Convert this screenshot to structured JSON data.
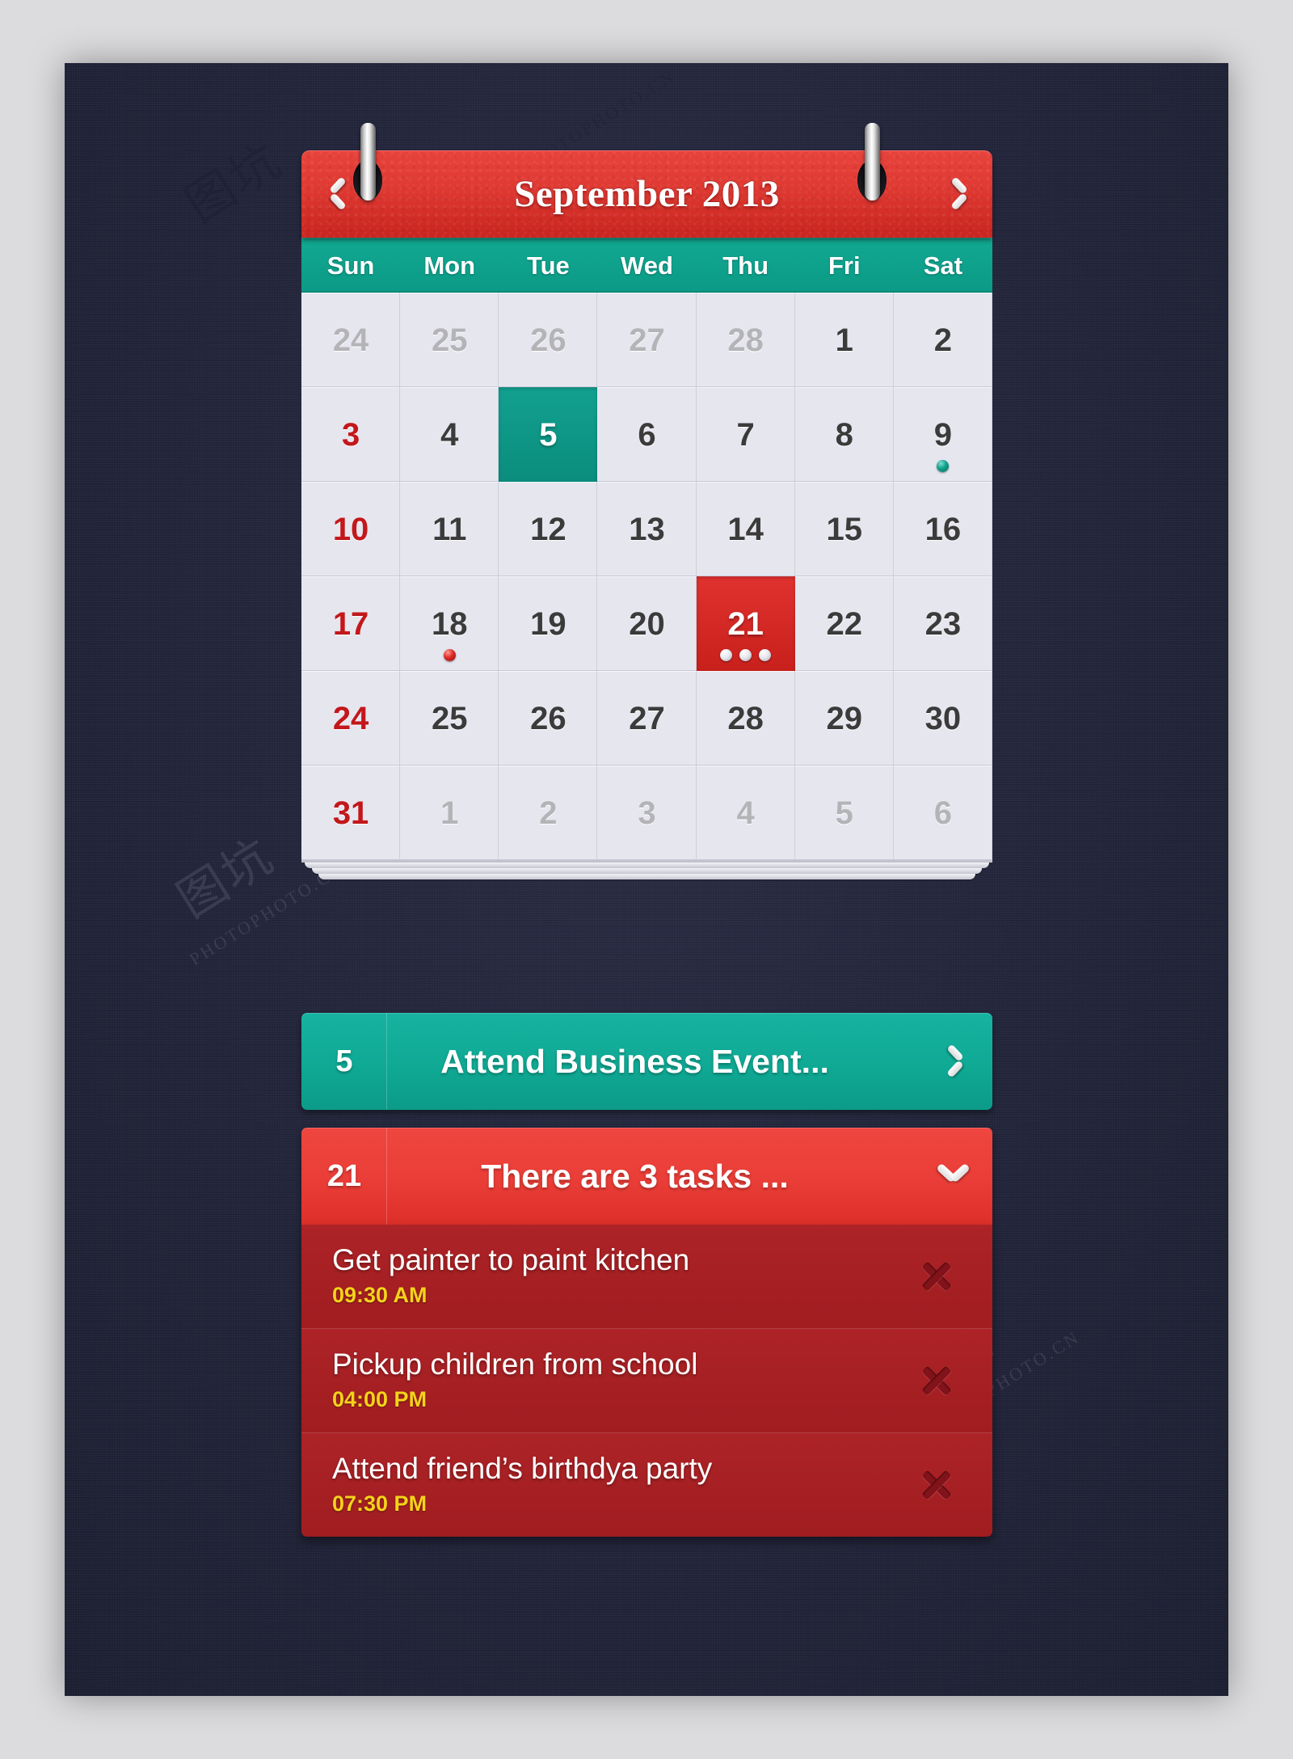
{
  "calendar": {
    "title": "September 2013",
    "prev_icon": "chevron-left-icon",
    "next_icon": "chevron-right-icon",
    "weekdays": [
      "Sun",
      "Mon",
      "Tue",
      "Wed",
      "Thu",
      "Fri",
      "Sat"
    ],
    "weeks": [
      [
        {
          "n": "24",
          "state": "muted"
        },
        {
          "n": "25",
          "state": "muted"
        },
        {
          "n": "26",
          "state": "muted"
        },
        {
          "n": "27",
          "state": "muted"
        },
        {
          "n": "28",
          "state": "muted"
        },
        {
          "n": "1",
          "state": "normal"
        },
        {
          "n": "2",
          "state": "normal"
        }
      ],
      [
        {
          "n": "3",
          "state": "sunday"
        },
        {
          "n": "4",
          "state": "normal"
        },
        {
          "n": "5",
          "state": "selected-teal"
        },
        {
          "n": "6",
          "state": "normal"
        },
        {
          "n": "7",
          "state": "normal"
        },
        {
          "n": "8",
          "state": "normal"
        },
        {
          "n": "9",
          "state": "normal",
          "dots": [
            "teal"
          ]
        }
      ],
      [
        {
          "n": "10",
          "state": "sunday"
        },
        {
          "n": "11",
          "state": "normal"
        },
        {
          "n": "12",
          "state": "normal"
        },
        {
          "n": "13",
          "state": "normal"
        },
        {
          "n": "14",
          "state": "normal"
        },
        {
          "n": "15",
          "state": "normal"
        },
        {
          "n": "16",
          "state": "normal"
        }
      ],
      [
        {
          "n": "17",
          "state": "sunday"
        },
        {
          "n": "18",
          "state": "normal",
          "dots": [
            "red"
          ]
        },
        {
          "n": "19",
          "state": "normal"
        },
        {
          "n": "20",
          "state": "normal"
        },
        {
          "n": "21",
          "state": "selected-red",
          "dots": [
            "white",
            "white",
            "white"
          ]
        },
        {
          "n": "22",
          "state": "normal"
        },
        {
          "n": "23",
          "state": "normal"
        }
      ],
      [
        {
          "n": "24",
          "state": "sunday"
        },
        {
          "n": "25",
          "state": "normal"
        },
        {
          "n": "26",
          "state": "normal"
        },
        {
          "n": "27",
          "state": "normal"
        },
        {
          "n": "28",
          "state": "normal"
        },
        {
          "n": "29",
          "state": "normal"
        },
        {
          "n": "30",
          "state": "normal"
        }
      ],
      [
        {
          "n": "31",
          "state": "sunday"
        },
        {
          "n": "1",
          "state": "muted"
        },
        {
          "n": "2",
          "state": "muted"
        },
        {
          "n": "3",
          "state": "muted"
        },
        {
          "n": "4",
          "state": "muted"
        },
        {
          "n": "5",
          "state": "muted"
        },
        {
          "n": "6",
          "state": "muted"
        }
      ]
    ]
  },
  "event_bar": {
    "date": "5",
    "label": "Attend Business Event...",
    "arrow_icon": "chevron-right-icon"
  },
  "tasks_bar": {
    "date": "21",
    "label": "There are 3 tasks ...",
    "arrow_icon": "chevron-down-icon"
  },
  "tasks": [
    {
      "title": "Get painter to paint kitchen",
      "time": "09:30 AM",
      "close_icon": "close-x-icon"
    },
    {
      "title": "Pickup children from school",
      "time": "04:00 PM",
      "close_icon": "close-x-icon"
    },
    {
      "title": "Attend friend’s birthdya party",
      "time": "07:30 PM",
      "close_icon": "close-x-icon"
    }
  ],
  "watermarks": {
    "text_big": "图坑",
    "text_site": "PHOTOPHOTO.CN"
  },
  "colors": {
    "canvas": "#23253b",
    "page": "#dcdcde",
    "header_red": "#e03a33",
    "teal": "#0fa994",
    "task_red": "#a31f22",
    "time_yellow": "#f5d21a",
    "sunday_red": "#c2181c",
    "cell_bg": "#e6e6ef"
  }
}
